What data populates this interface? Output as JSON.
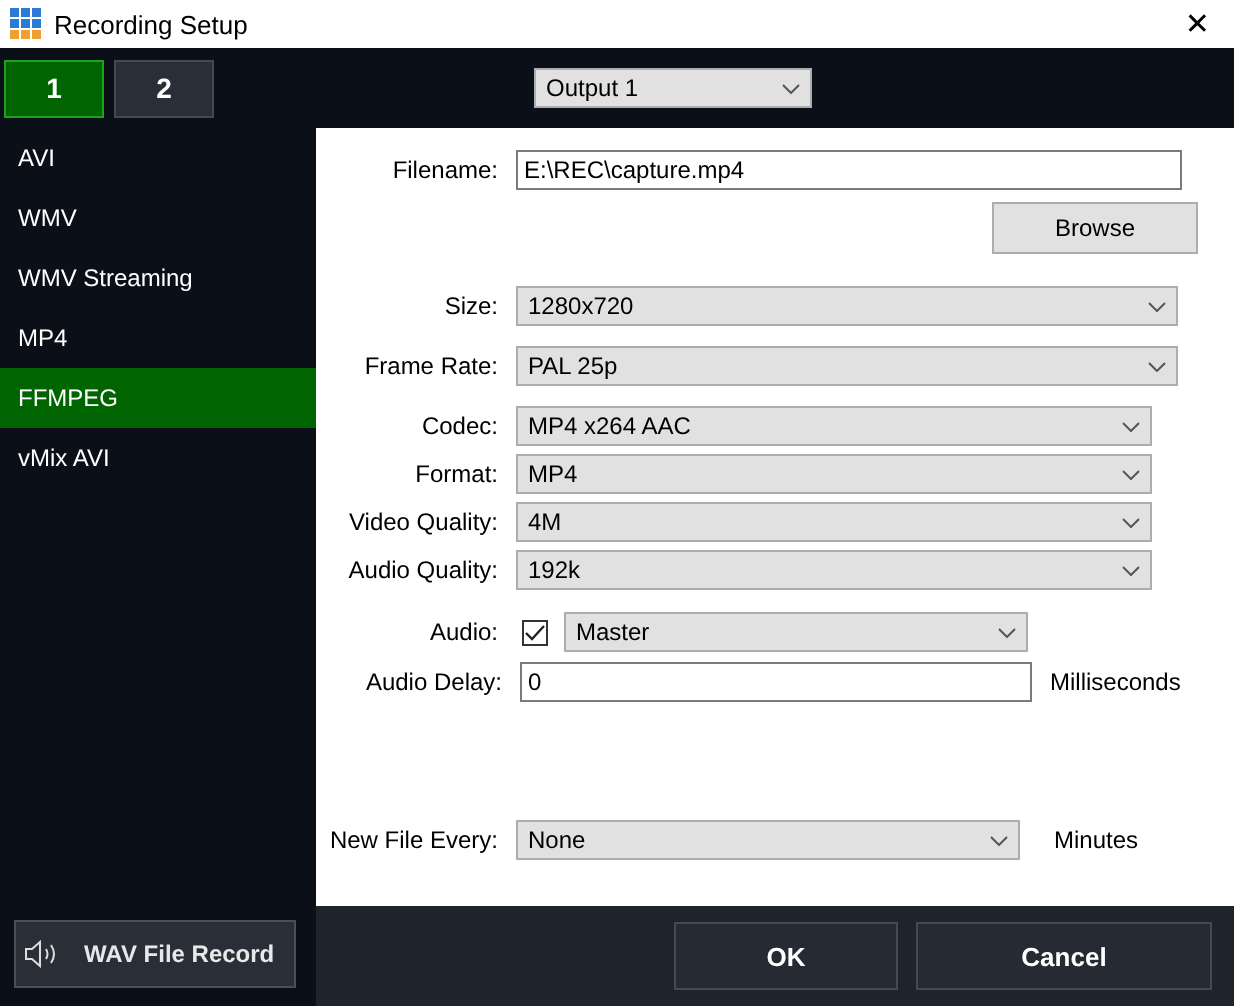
{
  "window": {
    "title": "Recording Setup",
    "close": "✕"
  },
  "tabs": [
    {
      "label": "1",
      "selected": true
    },
    {
      "label": "2",
      "selected": false
    }
  ],
  "output": {
    "value": "Output 1"
  },
  "sidebar": {
    "items": [
      {
        "label": "AVI",
        "selected": false
      },
      {
        "label": "WMV",
        "selected": false
      },
      {
        "label": "WMV Streaming",
        "selected": false
      },
      {
        "label": "MP4",
        "selected": false
      },
      {
        "label": "FFMPEG",
        "selected": true
      },
      {
        "label": "vMix AVI",
        "selected": false
      }
    ]
  },
  "filename": {
    "label": "Filename:",
    "value": "E:\\REC\\capture.mp4"
  },
  "browse_button": "Browse",
  "general": [
    {
      "label": "Size:",
      "value": "1280x720"
    },
    {
      "label": "Frame Rate:",
      "value": "PAL 25p"
    }
  ],
  "encoding": [
    {
      "label": "Codec:",
      "value": "MP4 x264 AAC"
    },
    {
      "label": "Format:",
      "value": "MP4"
    },
    {
      "label": "Video Quality:",
      "value": "4M"
    },
    {
      "label": "Audio Quality:",
      "value": "192k"
    }
  ],
  "audio": {
    "label": "Audio:",
    "checked": true,
    "value": "Master"
  },
  "audio_delay": {
    "label": "Audio Delay:",
    "value": "0",
    "unit": "Milliseconds"
  },
  "new_file_every": {
    "label": "New File Every:",
    "value": "None",
    "unit": "Minutes"
  },
  "wav_button": "WAV File Record",
  "buttons": [
    "OK",
    "Cancel"
  ]
}
